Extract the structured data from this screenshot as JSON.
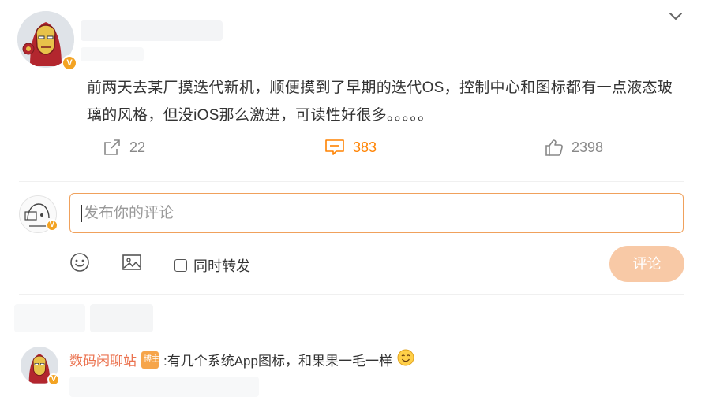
{
  "post": {
    "author_avatar": "iron-man-avatar",
    "text": "前两天去某厂摸迭代新机，顺便摸到了早期的迭代OS，控制中心和图标都有一点液态玻璃的风格，但没iOS那么激进，可读性好很多。。。。。",
    "stats": {
      "repost": "22",
      "comment": "383",
      "like": "2398"
    }
  },
  "composer": {
    "placeholder": "发布你的评论",
    "repost_label": "同时转发",
    "submit_label": "评论",
    "submit_color": "#f8c9a6",
    "border_color": "#f0a15c"
  },
  "reply": {
    "name": "数码闲聊站",
    "badge": "博主",
    "text": ":有几个系统App图标，和果果一毛一样"
  },
  "colors": {
    "accent": "#ff8200",
    "name_color": "#eb7350",
    "vip_badge": "#f3a323"
  }
}
